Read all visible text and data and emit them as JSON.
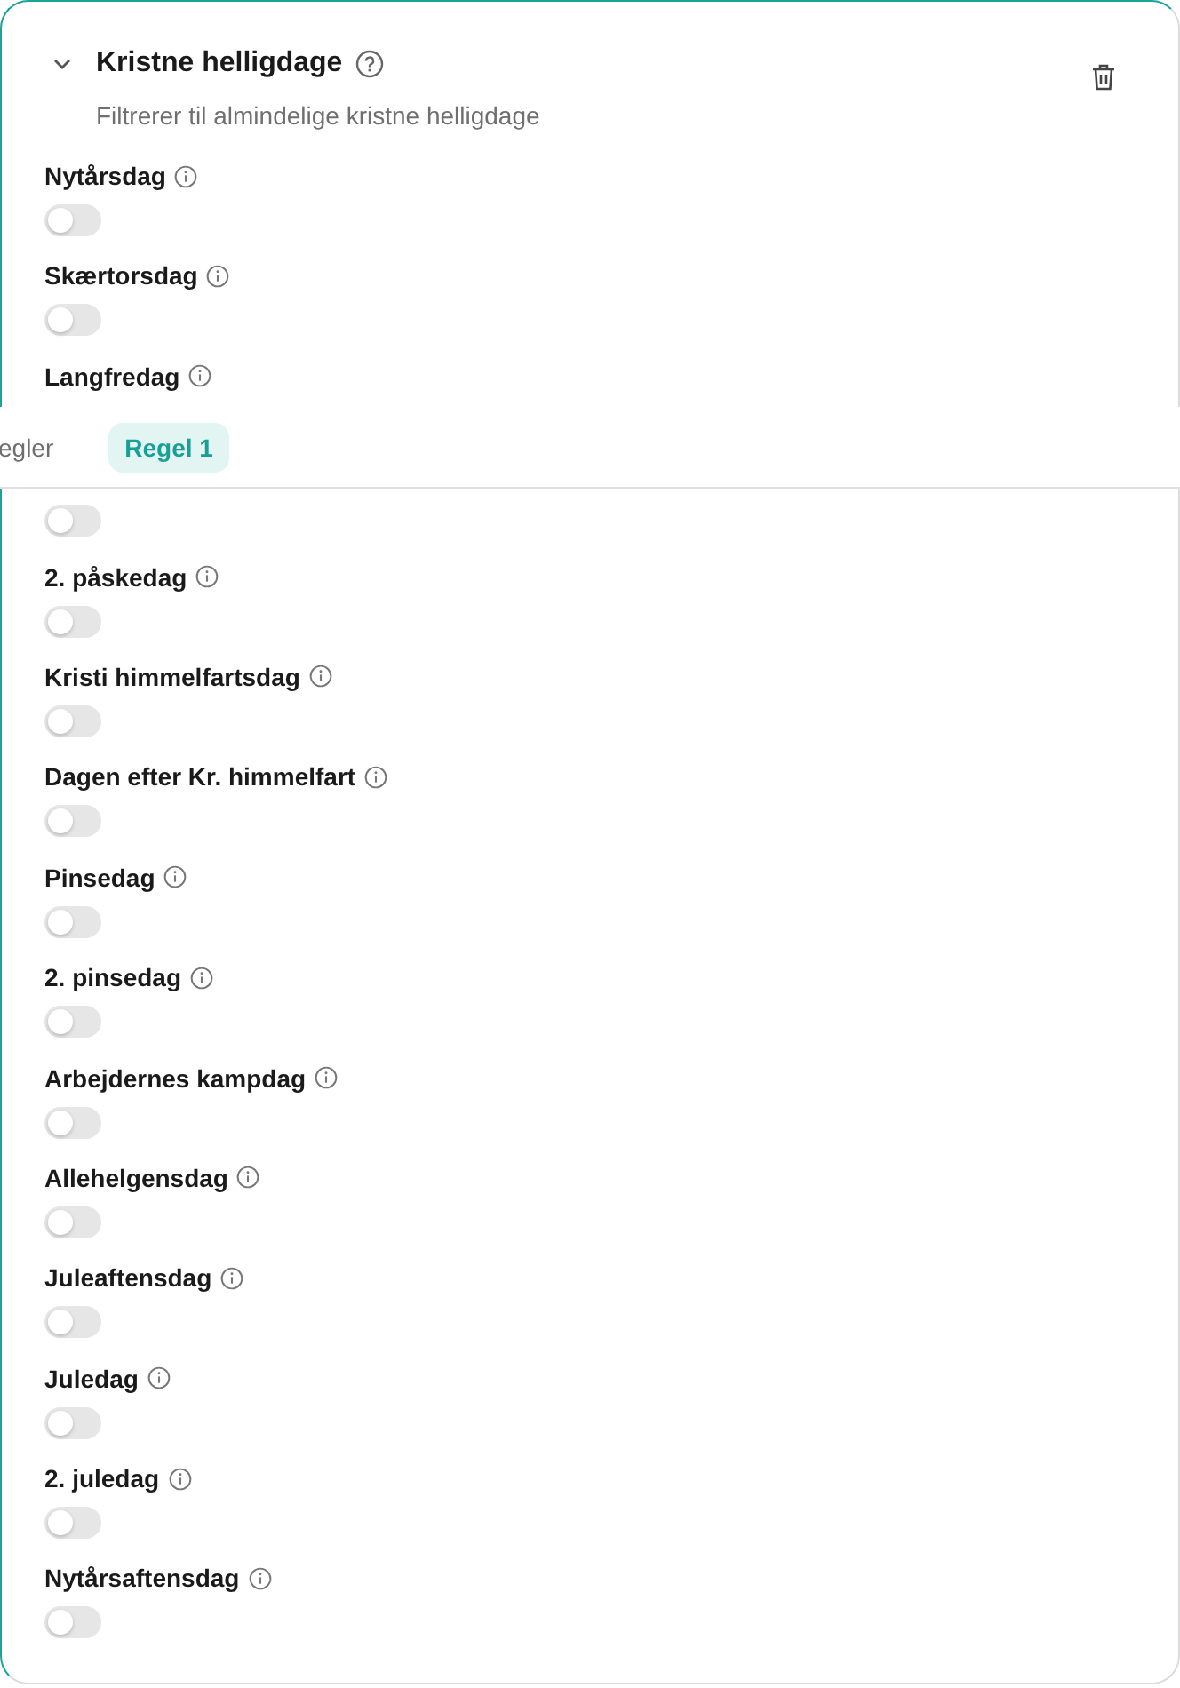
{
  "section": {
    "title": "Kristne helligdage",
    "description": "Filtrerer til almindelige kristne helligdage",
    "expanded": true
  },
  "holidays": [
    {
      "kind": "toggle",
      "label": "Nytårsdag",
      "on": false
    },
    {
      "kind": "toggle",
      "label": "Skærtorsdag",
      "on": false
    },
    {
      "kind": "label_only",
      "label": "Langfredag"
    },
    {
      "kind": "toggle_only",
      "on": false
    },
    {
      "kind": "toggle",
      "label": "2. påskedag",
      "on": false
    },
    {
      "kind": "toggle",
      "label": "Kristi himmelfartsdag",
      "on": false
    },
    {
      "kind": "toggle",
      "label": "Dagen efter Kr. himmelfart",
      "on": false
    },
    {
      "kind": "toggle",
      "label": "Pinsedag",
      "on": false
    },
    {
      "kind": "toggle",
      "label": "2. pinsedag",
      "on": false
    },
    {
      "kind": "toggle",
      "label": "Arbejdernes kampdag",
      "on": false
    },
    {
      "kind": "toggle",
      "label": "Allehelgensdag",
      "on": false
    },
    {
      "kind": "toggle",
      "label": "Juleaftensdag",
      "on": false
    },
    {
      "kind": "toggle",
      "label": "Juledag",
      "on": false
    },
    {
      "kind": "toggle",
      "label": "2. juledag",
      "on": false
    },
    {
      "kind": "toggle",
      "label": "Nytårsaftensdag",
      "on": false
    }
  ],
  "tab_bar": {
    "tabs": [
      {
        "label": "egler",
        "selected": false
      },
      {
        "label": "Regel 1",
        "selected": true
      }
    ]
  }
}
